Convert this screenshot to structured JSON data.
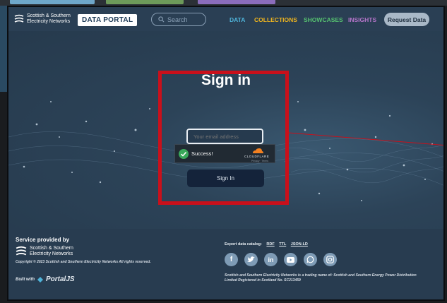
{
  "brand": {
    "line1": "Scottish & Southern",
    "line2": "Electricity Networks",
    "portal": "DATA PORTAL"
  },
  "search": {
    "placeholder": "Search"
  },
  "nav": [
    {
      "label": "DATA",
      "color": "#4fb3d9"
    },
    {
      "label": "COLLECTIONS",
      "color": "#f0b51e"
    },
    {
      "label": "SHOWCASES",
      "color": "#56c070"
    },
    {
      "label": "INSIGHTS",
      "color": "#b474c9"
    }
  ],
  "request_data": "Request Data",
  "signin": {
    "title": "Sign in",
    "email_placeholder": "Your email address",
    "captcha_status": "Success!",
    "captcha_brand": "CLOUDFLARE",
    "captcha_links": "Privacy · Terms",
    "button": "Sign In"
  },
  "footer": {
    "service_title": "Service provided by",
    "brand_line1": "Scottish & Southern",
    "brand_line2": "Electricity Networks",
    "copyright": "Copyright © 2023 Scottish and Southern Electricity Networks All rights reserved.",
    "built_with": "Built with",
    "portaljs": "PortalJS",
    "export_label": "Export data catalog:",
    "export_links": [
      "RDF",
      "TTL",
      "JSON-LD"
    ],
    "socials": [
      "facebook-icon",
      "twitter-icon",
      "linkedin-icon",
      "youtube-icon",
      "whatsapp-icon",
      "instagram-icon"
    ],
    "legal": "Scottish and Southern Electricity Networks is a trading name of: Scottish and Southern Energy Power Distribution Limited Registered in Scotland No. SC213459"
  },
  "colors": {
    "annotation": "#c9101b",
    "background": "#283d51",
    "accent": "#a9b8c7"
  }
}
